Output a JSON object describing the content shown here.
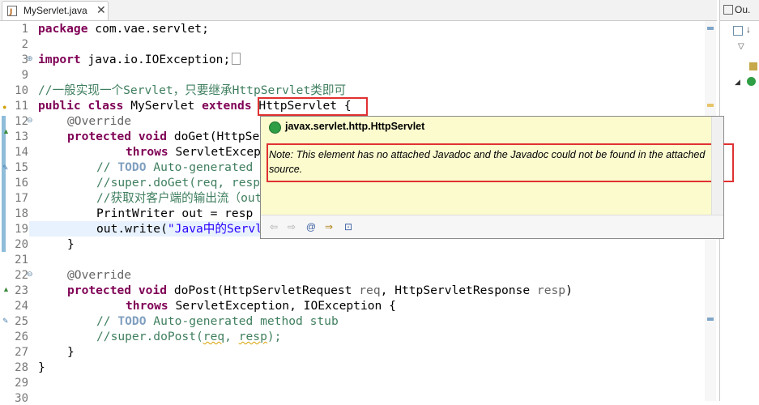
{
  "editor_tab": {
    "label": "MyServlet.java",
    "close": "✕"
  },
  "outline_tab": {
    "label": "Ou."
  },
  "line_numbers": [
    "1",
    "2",
    "3",
    "9",
    "10",
    "11",
    "12",
    "13",
    "14",
    "15",
    "16",
    "17",
    "18",
    "19",
    "20",
    "21",
    "22",
    "23",
    "24",
    "25",
    "26",
    "27",
    "28",
    "29",
    "30"
  ],
  "code": {
    "l1_kw": "package",
    "l1_rest": " com.vae.servlet;",
    "l3_kw": "import",
    "l3_rest": " java.io.IOException;",
    "l11_comment": "//一般实现一个Servlet，只要继承HttpServlet类即可",
    "l12_kw1": "public",
    "l12_kw2": "class",
    "l12_name": " MyServlet ",
    "l12_kw3": "extends",
    "l12_super": " HttpServlet {",
    "l13": "@Override",
    "l14_kw1": "protected",
    "l14_kw2": "void",
    "l14_rest": " doGet(HttpSe",
    "l15_kw": "throws",
    "l15_rest": " ServletExcep",
    "l16_c1": "// ",
    "l16_task": "TODO",
    "l16_c2": " Auto-generated",
    "l17": "//super.doGet(req, resp",
    "l18": "//获取对客户端的输出流（out对象",
    "l19": "PrintWriter out = resp",
    "l20_a": "out.write(",
    "l20_str": "\"Java中的Servl",
    "l21": "}",
    "l23": "@Override",
    "l24_kw1": "protected",
    "l24_kw2": "void",
    "l24_rest": " doPost(HttpServletRequest ",
    "l24_p1": "req",
    "l24_mid": ", HttpServletResponse ",
    "l24_p2": "resp",
    "l24_end": ")",
    "l25_kw": "throws",
    "l25_rest": " ServletException, IOException {",
    "l26_c1": "// ",
    "l26_task": "TODO",
    "l26_c2": " Auto-generated method stub",
    "l27_a": "//super.doPost(",
    "l27_req": "req",
    "l27_mid": ", ",
    "l27_resp": "resp",
    "l27_end": ");",
    "l28": "}",
    "l29": "}"
  },
  "hover": {
    "title": "javax.servlet.http.HttpServlet",
    "note": "Note: This element has no attached Javadoc and the Javadoc could not be found in the attached source.",
    "toolbar": [
      "back",
      "forward",
      "@",
      "open-declaration",
      "show-in-javadoc-view"
    ],
    "toolbar_glyphs": [
      "⇦",
      "⇨",
      "@",
      "⇒",
      "⊡"
    ]
  },
  "colors": {
    "keyword": "#7f0055",
    "comment": "#3f7f5f",
    "annotation_box": "#e03131",
    "hover_bg": "#fbfbce"
  }
}
